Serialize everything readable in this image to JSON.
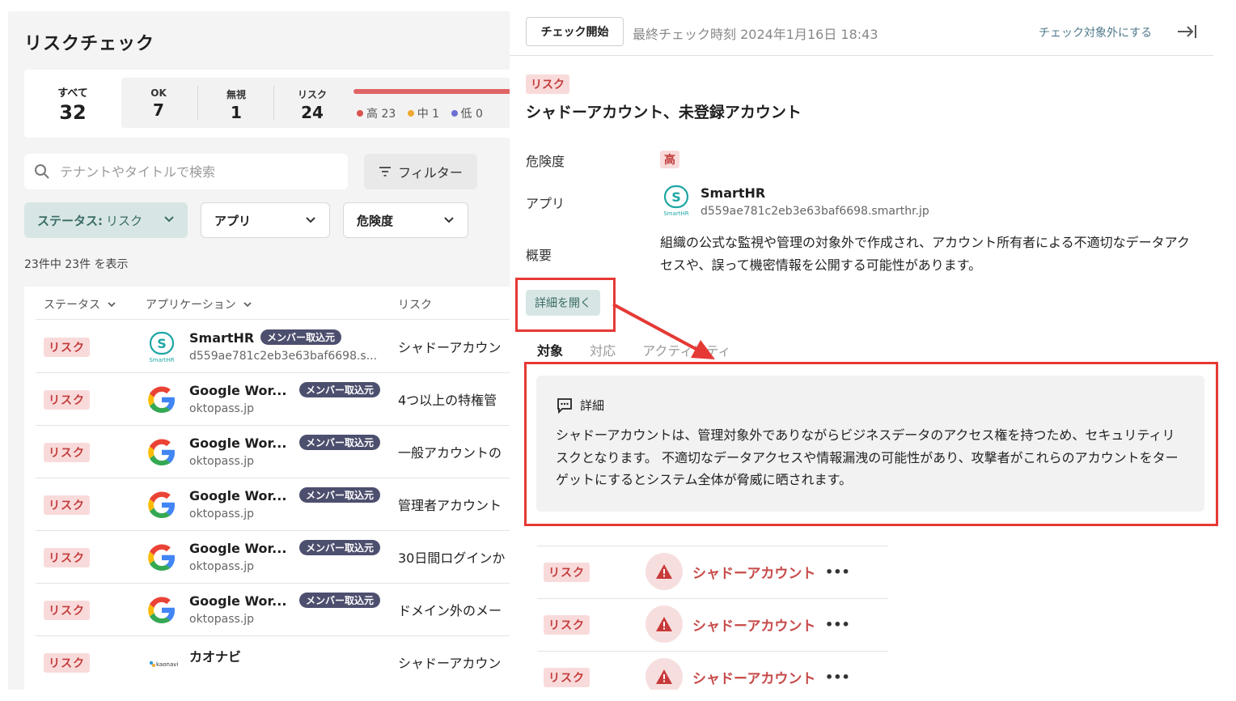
{
  "left": {
    "title": "リスクチェック",
    "stats": {
      "all_label": "すべて",
      "all_value": "32",
      "ok_label": "OK",
      "ok_value": "7",
      "ignore_label": "無視",
      "ignore_value": "1",
      "risk_label": "リスク",
      "risk_value": "24",
      "levels": [
        {
          "label": "高 23",
          "color": "#d9534f"
        },
        {
          "label": "中 1",
          "color": "#f0a830"
        },
        {
          "label": "低 0",
          "color": "#6b6fd6"
        }
      ]
    },
    "search_placeholder": "テナントやタイトルで検索",
    "filter_label": "フィルター",
    "dropdowns": {
      "status_key": "ステータス:",
      "status_value": "リスク",
      "app": "アプリ",
      "severity": "危険度"
    },
    "count_text": "23件中 23件 を表示",
    "table": {
      "headers": {
        "status": "ステータス",
        "application": "アプリケーション",
        "risk": "リスク"
      },
      "rows": [
        {
          "status": "リスク",
          "app_name": "SmartHR",
          "app_sub": "d559ae781c2eb3e63baf6698.s...",
          "tag": "メンバー取込元",
          "risk": "シャドーアカウン",
          "icon": "smarthr-icon"
        },
        {
          "status": "リスク",
          "app_name": "Google Wor...",
          "app_sub": "oktopass.jp",
          "tag": "メンバー取込元",
          "risk": "4つ以上の特権管",
          "icon": "google-icon"
        },
        {
          "status": "リスク",
          "app_name": "Google Wor...",
          "app_sub": "oktopass.jp",
          "tag": "メンバー取込元",
          "risk": "一般アカウントの",
          "icon": "google-icon"
        },
        {
          "status": "リスク",
          "app_name": "Google Wor...",
          "app_sub": "oktopass.jp",
          "tag": "メンバー取込元",
          "risk": "管理者アカウント",
          "icon": "google-icon"
        },
        {
          "status": "リスク",
          "app_name": "Google Wor...",
          "app_sub": "oktopass.jp",
          "tag": "メンバー取込元",
          "risk": "30日間ログインか",
          "icon": "google-icon"
        },
        {
          "status": "リスク",
          "app_name": "Google Wor...",
          "app_sub": "oktopass.jp",
          "tag": "メンバー取込元",
          "risk": "ドメイン外のメー",
          "icon": "google-icon"
        },
        {
          "status": "リスク",
          "app_name": "カオナビ",
          "app_sub": "",
          "tag": "",
          "risk": "シャドーアカウン",
          "icon": "kaonavi-icon"
        }
      ]
    }
  },
  "right": {
    "check_button": "チェック開始",
    "last_check": "最終チェック時刻 2024年1月16日 18:43",
    "exclude_link": "チェック対象外にする",
    "badge": "リスク",
    "title": "シャドーアカウント、未登録アカウント",
    "severity_label": "危険度",
    "severity_value": "高",
    "app_label": "アプリ",
    "app_name": "SmartHR",
    "app_sub": "d559ae781c2eb3e63baf6698.smarthr.jp",
    "summary_label": "概要",
    "summary_text": "組織の公式な監視や管理の対象外で作成され、アカウント所有者による不適切なデータアクセスや、誤って機密情報を公開する可能性があります。",
    "detail_button": "詳細を開く",
    "tabs": [
      "対象",
      "対応",
      "アクティビティ"
    ],
    "detail_card": {
      "header": "詳細",
      "body": "シャドーアカウントは、管理対象外でありながらビジネスデータのアクセス権を持つため、セキュリティリスクとなります。 不適切なデータアクセスや情報漏洩の可能性があり、攻撃者がこれらのアカウントをターゲットにするとシステム全体が脅威に晒されます。"
    },
    "list": [
      {
        "status": "リスク",
        "title": "シャドーアカウント"
      },
      {
        "status": "リスク",
        "title": "シャドーアカウント"
      },
      {
        "status": "リスク",
        "title": "シャドーアカウント"
      }
    ]
  },
  "colors": {
    "risk_red": "#c23b3b",
    "annotation_red": "#e53935",
    "teal": "#3a6b66"
  }
}
